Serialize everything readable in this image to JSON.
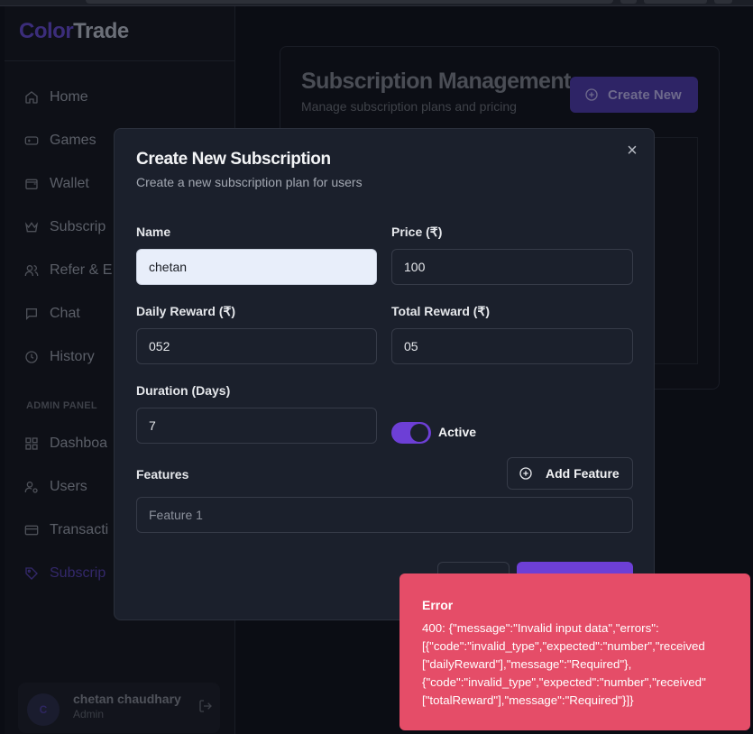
{
  "app": {
    "logo_part1": "Color",
    "logo_part2": "Trade"
  },
  "sidebar": {
    "nav": [
      {
        "label": "Home",
        "icon": "home-icon"
      },
      {
        "label": "Games",
        "icon": "gamepad-icon"
      },
      {
        "label": "Wallet",
        "icon": "wallet-icon"
      },
      {
        "label": "Subscrip",
        "icon": "crown-icon"
      },
      {
        "label": "Refer & E",
        "icon": "users-icon"
      },
      {
        "label": "Chat",
        "icon": "chat-icon"
      },
      {
        "label": "History",
        "icon": "history-icon"
      }
    ],
    "admin_label": "ADMIN PANEL",
    "admin_nav": [
      {
        "label": "Dashboa",
        "icon": "dashboard-icon"
      },
      {
        "label": "Users",
        "icon": "user-cog-icon"
      },
      {
        "label": "Transacti",
        "icon": "card-icon"
      },
      {
        "label": "Subscrip",
        "icon": "tag-icon",
        "active": true
      }
    ],
    "user": {
      "initial": "C",
      "name": "chetan chaudhary",
      "role": "Admin"
    }
  },
  "page": {
    "title": "Subscription Management",
    "subtitle": "Manage subscription plans and pricing",
    "create_button": "Create New"
  },
  "modal": {
    "title": "Create New Subscription",
    "subtitle": "Create a new subscription plan for users",
    "fields": {
      "name": {
        "label": "Name",
        "value": "chetan"
      },
      "price": {
        "label": "Price (₹)",
        "value": "100"
      },
      "daily_reward": {
        "label": "Daily Reward (₹)",
        "value": "052"
      },
      "total_reward": {
        "label": "Total Reward (₹)",
        "value": "05"
      },
      "duration": {
        "label": "Duration (Days)",
        "value": "7"
      }
    },
    "active_label": "Active",
    "active": true,
    "features_label": "Features",
    "add_feature_button": "Add Feature",
    "feature_placeholder": "Feature 1"
  },
  "toast": {
    "title": "Error",
    "message": "400: {\"message\":\"Invalid input data\",\"errors\":\n[{\"code\":\"invalid_type\",\"expected\":\"number\",\"received\n[\"dailyReward\"],\"message\":\"Required\"},\n{\"code\":\"invalid_type\",\"expected\":\"number\",\"received\"\n[\"totalReward\"],\"message\":\"Required\"}]}"
  },
  "colors": {
    "accent": "#6d3fd6",
    "error": "#e54d68",
    "modal_bg": "#1b202c"
  }
}
